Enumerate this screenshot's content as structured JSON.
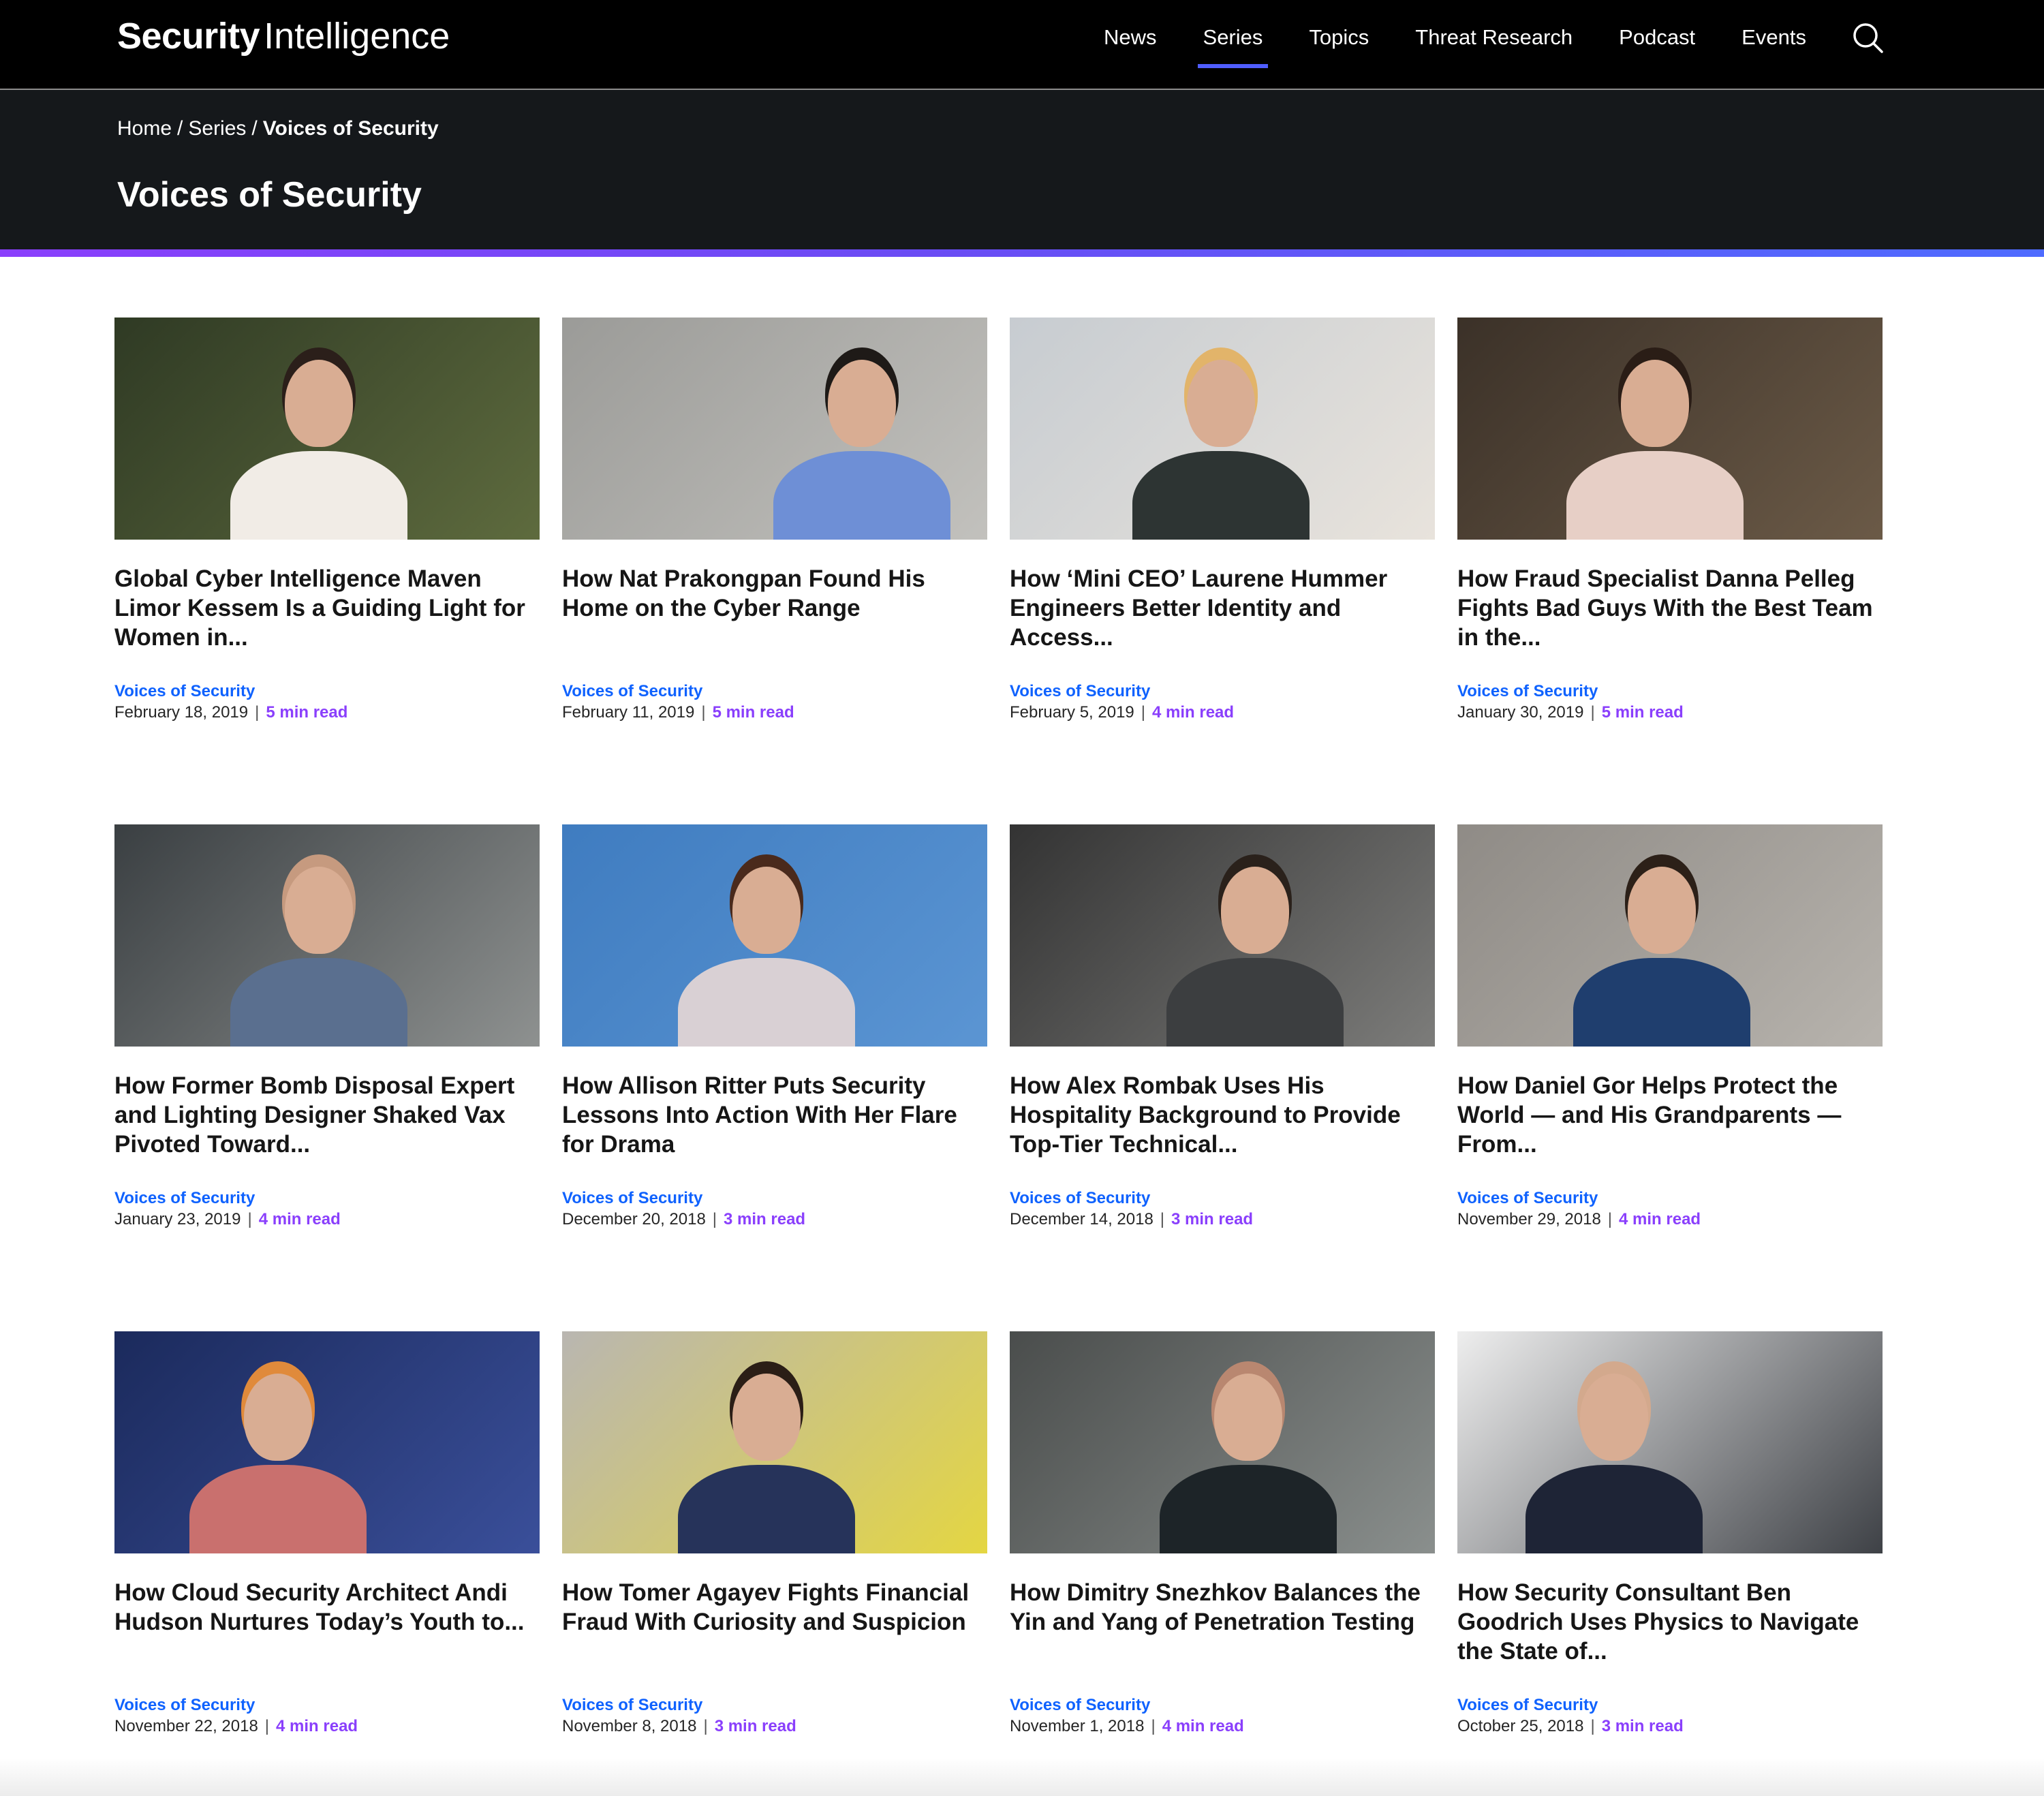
{
  "header": {
    "logo_bold": "Security",
    "logo_light": "Intelligence",
    "nav": [
      {
        "label": "News"
      },
      {
        "label": "Series"
      },
      {
        "label": "Topics"
      },
      {
        "label": "Threat Research"
      },
      {
        "label": "Podcast"
      },
      {
        "label": "Events"
      }
    ],
    "active_nav": "Series",
    "search_icon": "search-icon"
  },
  "hero": {
    "breadcrumb": [
      "Home",
      "Series",
      "Voices of Security"
    ],
    "breadcrumb_separator": "/",
    "title": "Voices of Security"
  },
  "colors": {
    "accent_purple": "#8a3ffc",
    "link_blue": "#0f62fe",
    "nav_active": "#4f5dff",
    "hero_bg": "#15181b"
  },
  "articles": [
    {
      "title": "Global Cyber Intelligence Maven Limor Kessem Is a Guiding Light for Women in...",
      "category": "Voices of Security",
      "date": "February 18, 2019",
      "read_time": "5 min read",
      "photo": [
        "#2f3a24",
        "#5e6b3e",
        "#f1ece6",
        "#2b1f1a"
      ]
    },
    {
      "title": "How Nat Prakongpan Found His Home on the Cyber Range",
      "category": "Voices of Security",
      "date": "February 11, 2019",
      "read_time": "5 min read",
      "photo": [
        "#9b9b98",
        "#c2c1bd",
        "#6e8fd6",
        "#1e1a17"
      ]
    },
    {
      "title": "How ‘Mini CEO’ Laurene Hummer Engineers Better Identity and Access...",
      "category": "Voices of Security",
      "date": "February 5, 2019",
      "read_time": "4 min read",
      "photo": [
        "#c7ccd1",
        "#e8e3dc",
        "#2d3433",
        "#e2b46a"
      ]
    },
    {
      "title": "How Fraud Specialist Danna Pelleg Fights Bad Guys With the Best Team in the...",
      "category": "Voices of Security",
      "date": "January 30, 2019",
      "read_time": "5 min read",
      "photo": [
        "#3b3128",
        "#6b5a47",
        "#e7cfc6",
        "#2a1d16"
      ]
    },
    {
      "title": "How Former Bomb Disposal Expert and Lighting Designer Shaked Vax Pivoted Toward...",
      "category": "Voices of Security",
      "date": "January 23, 2019",
      "read_time": "4 min read",
      "photo": [
        "#3a3f42",
        "#8e9190",
        "#5a6f8f",
        "#c69a7f"
      ]
    },
    {
      "title": "How Allison Ritter Puts Security Lessons Into Action With Her Flare for Drama",
      "category": "Voices of Security",
      "date": "December 20, 2018",
      "read_time": "3 min read",
      "photo": [
        "#3f7cc0",
        "#5b95d3",
        "#d9d0d4",
        "#4a2a1c"
      ]
    },
    {
      "title": "How Alex Rombak Uses His Hospitality Background to Provide Top-Tier Technical...",
      "category": "Voices of Security",
      "date": "December 14, 2018",
      "read_time": "3 min read",
      "photo": [
        "#333333",
        "#7c7c7a",
        "#3c3e40",
        "#2a211b"
      ]
    },
    {
      "title": "How Daniel Gor Helps Protect the World — and His Grandparents — From...",
      "category": "Voices of Security",
      "date": "November 29, 2018",
      "read_time": "4 min read",
      "photo": [
        "#8f8b86",
        "#b7b3ad",
        "#1f3e6e",
        "#2c2018"
      ]
    },
    {
      "title": "How Cloud Security Architect Andi Hudson Nurtures Today’s Youth to...",
      "category": "Voices of Security",
      "date": "November 22, 2018",
      "read_time": "4 min read",
      "photo": [
        "#1b2a5c",
        "#3a4f9a",
        "#c9706e",
        "#e08a3b"
      ]
    },
    {
      "title": "How Tomer Agayev Fights Financial Fraud With Curiosity and Suspicion",
      "category": "Voices of Security",
      "date": "November 8, 2018",
      "read_time": "3 min read",
      "photo": [
        "#b9b6b1",
        "#e4d642",
        "#26335a",
        "#2b1e16"
      ]
    },
    {
      "title": "How Dimitry Snezhkov Balances the Yin and Yang of Penetration Testing",
      "category": "Voices of Security",
      "date": "November 1, 2018",
      "read_time": "4 min read",
      "photo": [
        "#4a4d4c",
        "#8a8f8d",
        "#1d2428",
        "#b98770"
      ]
    },
    {
      "title": "How Security Consultant Ben Goodrich Uses Physics to Navigate the State of...",
      "category": "Voices of Security",
      "date": "October 25, 2018",
      "read_time": "3 min read",
      "photo": [
        "#eeeeee",
        "#3e4146",
        "#1e2436",
        "#d3a98d"
      ]
    }
  ]
}
